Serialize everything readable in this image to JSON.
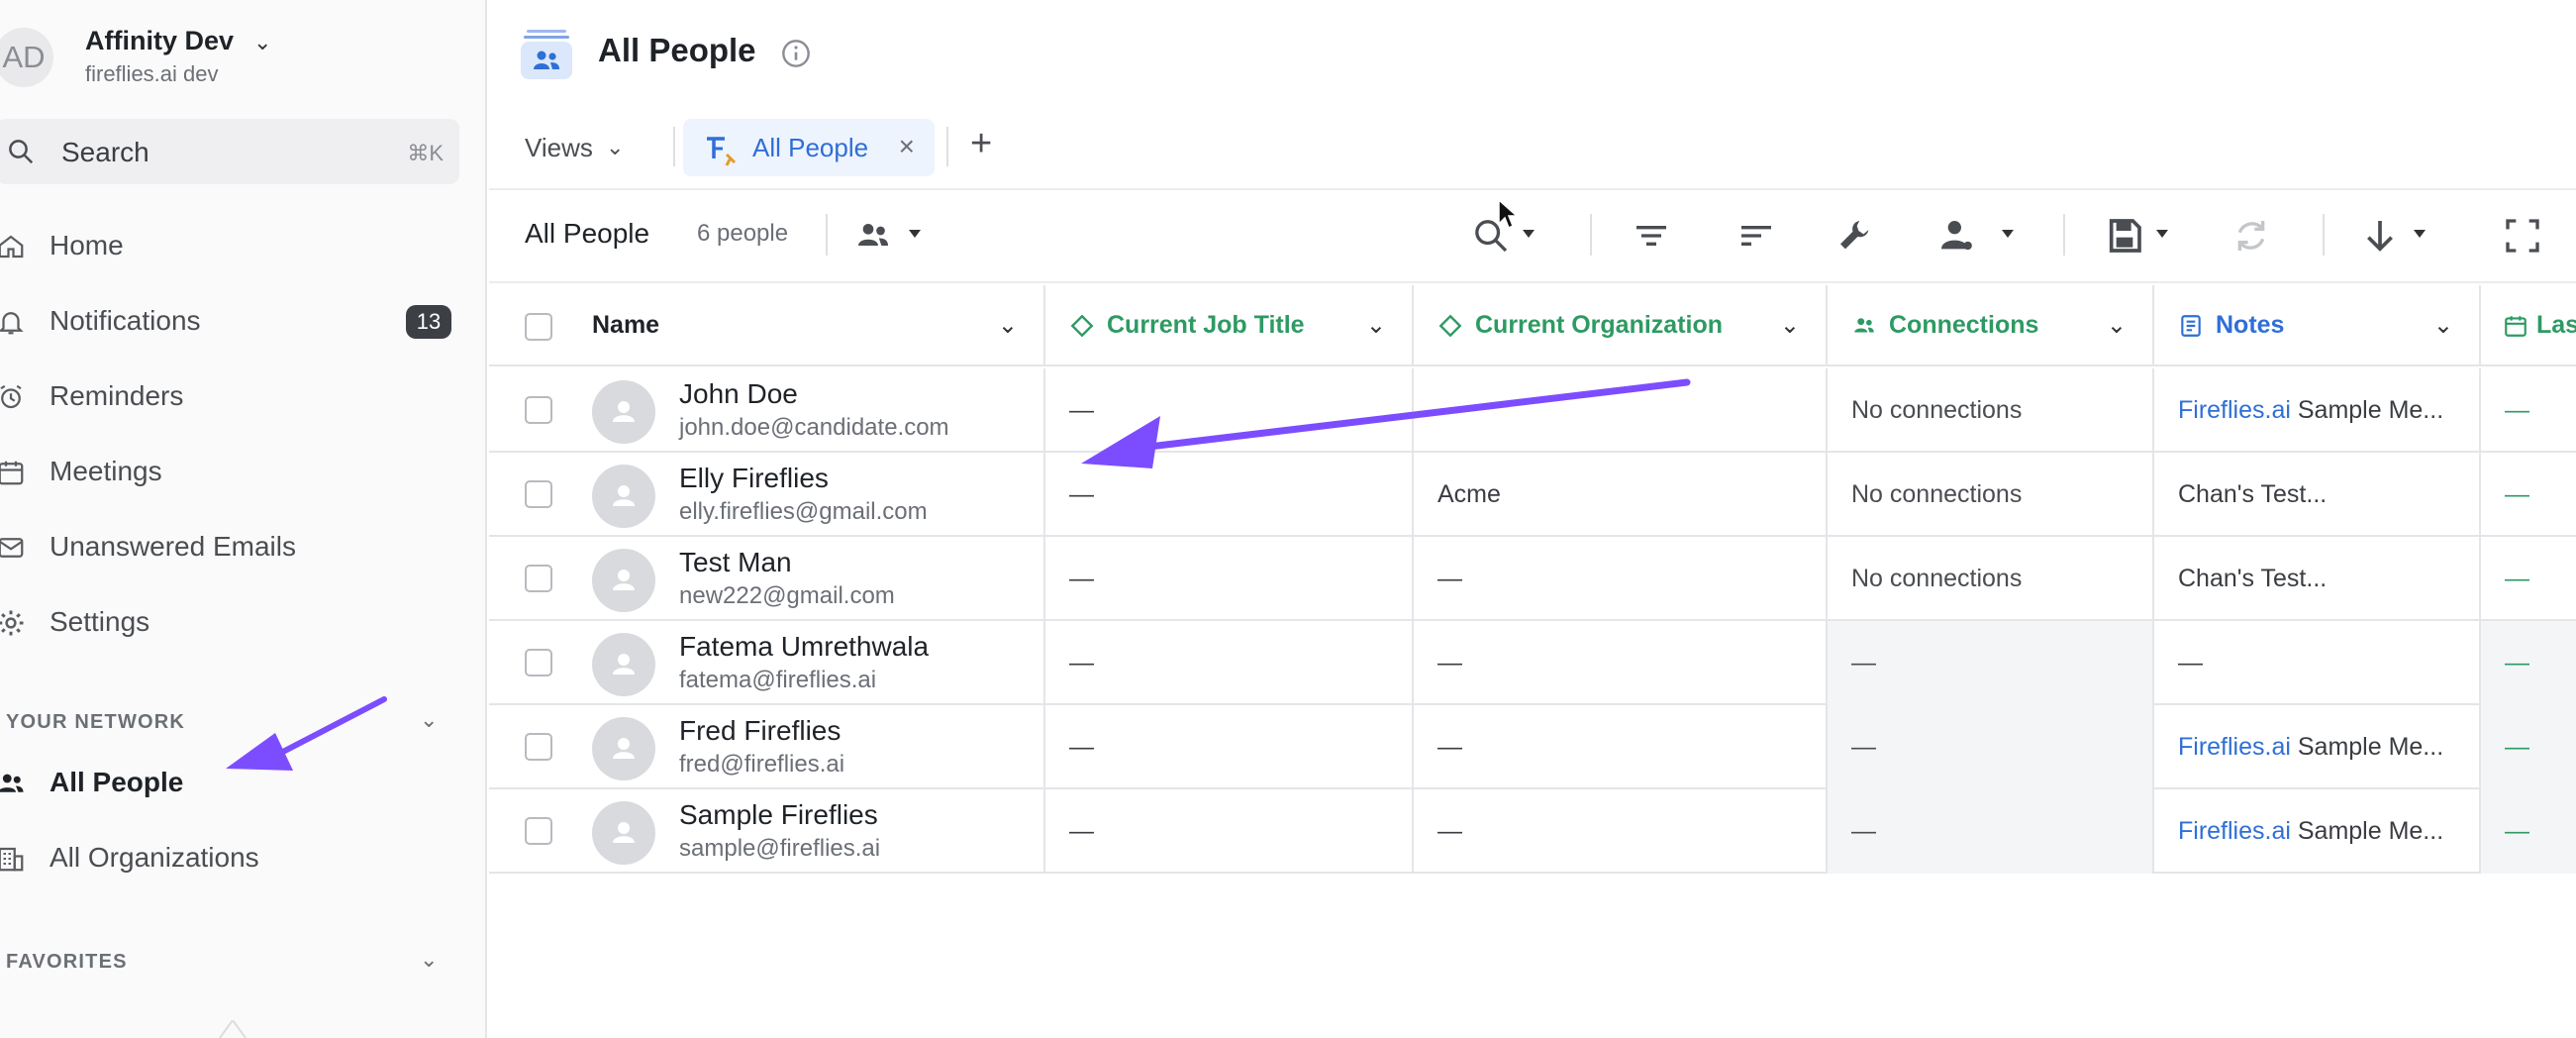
{
  "workspace": {
    "initials": "AD",
    "name": "Affinity Dev",
    "subtitle": "fireflies.ai dev"
  },
  "search": {
    "label": "Search",
    "shortcut": "⌘K"
  },
  "nav": [
    {
      "label": "Home",
      "icon": "home-icon"
    },
    {
      "label": "Notifications",
      "icon": "bell-icon",
      "badge": "13"
    },
    {
      "label": "Reminders",
      "icon": "alarm-clock-icon"
    },
    {
      "label": "Meetings",
      "icon": "calendar-icon"
    },
    {
      "label": "Unanswered Emails",
      "icon": "mail-icon"
    },
    {
      "label": "Settings",
      "icon": "gear-icon"
    }
  ],
  "network": {
    "heading": "YOUR NETWORK",
    "items": [
      {
        "label": "All People",
        "icon": "people-icon",
        "active": true
      },
      {
        "label": "All Organizations",
        "icon": "building-icon"
      }
    ]
  },
  "favorites": {
    "heading": "FAVORITES"
  },
  "page": {
    "title": "All People"
  },
  "viewbar": {
    "views_label": "Views",
    "active_tab": "All People"
  },
  "toolbar": {
    "title": "All People",
    "count": "6 people"
  },
  "columns": {
    "name": "Name",
    "job_title": "Current Job Title",
    "organization": "Current Organization",
    "connections": "Connections",
    "notes": "Notes",
    "last": "Las"
  },
  "rows": [
    {
      "name": "John Doe",
      "email": "john.doe@candidate.com",
      "job": "—",
      "org": "—",
      "connections": "No connections",
      "notes_link": "Fireflies.ai",
      "notes_rest": " Sample Me...",
      "last": "—"
    },
    {
      "name": "Elly Fireflies",
      "email": "elly.fireflies@gmail.com",
      "job": "—",
      "org": "Acme",
      "connections": "No connections",
      "notes_link": "",
      "notes_rest": "Chan's Test...",
      "last": "—"
    },
    {
      "name": "Test Man",
      "email": "new222@gmail.com",
      "job": "—",
      "org": "—",
      "connections": "No connections",
      "notes_link": "",
      "notes_rest": "Chan's Test...",
      "last": "—"
    },
    {
      "name": "Fatema Umrethwala",
      "email": "fatema@fireflies.ai",
      "job": "—",
      "org": "—",
      "connections": "—",
      "notes_link": "",
      "notes_rest": "—",
      "last": "—"
    },
    {
      "name": "Fred Fireflies",
      "email": "fred@fireflies.ai",
      "job": "—",
      "org": "—",
      "connections": "—",
      "notes_link": "Fireflies.ai",
      "notes_rest": " Sample Me...",
      "last": "—"
    },
    {
      "name": "Sample Fireflies",
      "email": "sample@fireflies.ai",
      "job": "—",
      "org": "—",
      "connections": "—",
      "notes_link": "Fireflies.ai",
      "notes_rest": " Sample Me...",
      "last": "—"
    }
  ],
  "colors": {
    "accent": "#2f6fd6",
    "green": "#2e9a63",
    "annotation": "#7c4dff"
  }
}
